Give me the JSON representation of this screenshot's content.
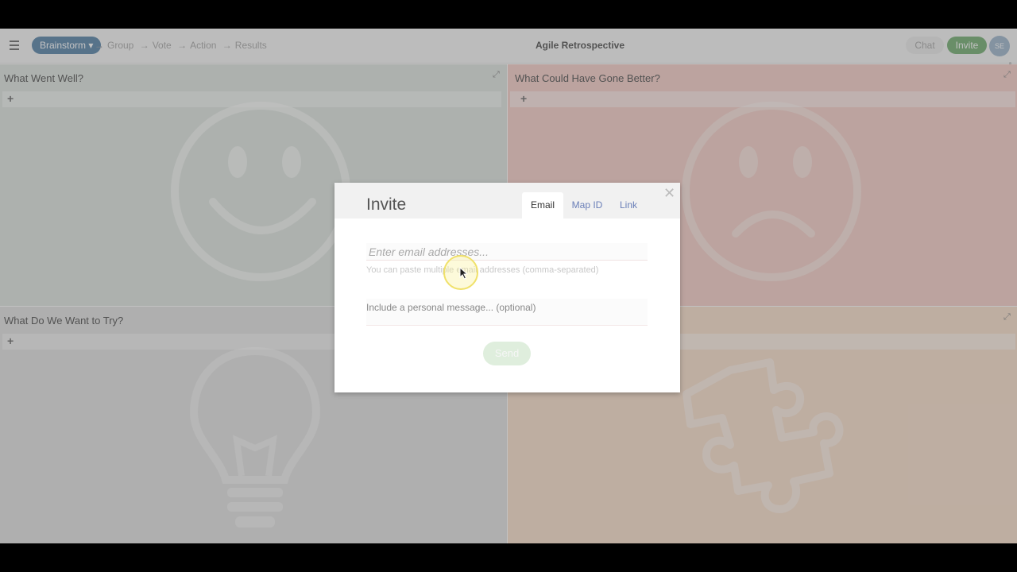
{
  "topbar": {
    "current_stage": "Brainstorm",
    "stages": [
      "Group",
      "Vote",
      "Action",
      "Results"
    ],
    "title": "Agile Retrospective",
    "chat_label": "Chat",
    "invite_label": "Invite",
    "avatar_initials": "SE"
  },
  "quadrants": [
    {
      "title": "What Went Well?",
      "icon": "smiley-face-icon",
      "color": "#d9e0db"
    },
    {
      "title": "What Could Have Gone Better?",
      "icon": "sad-face-icon",
      "color": "#f4c7bf"
    },
    {
      "title": "What Do We Want to Try?",
      "icon": "lightbulb-icon",
      "color": "#dcdcdc"
    },
    {
      "title": "",
      "icon": "puzzle-piece-icon",
      "color": "#f8dac4"
    }
  ],
  "modal": {
    "title": "Invite",
    "tabs": [
      "Email",
      "Map ID",
      "Link"
    ],
    "active_tab": "Email",
    "email_placeholder": "Enter email addresses...",
    "email_hint": "You can paste multiple email addresses (comma-separated)",
    "message_placeholder": "Include a personal message... (optional)",
    "send_label": "Send"
  },
  "colors": {
    "brand_blue": "#3d6f9a",
    "invite_green": "#5da05b",
    "tab_link": "#6a7fb8"
  }
}
